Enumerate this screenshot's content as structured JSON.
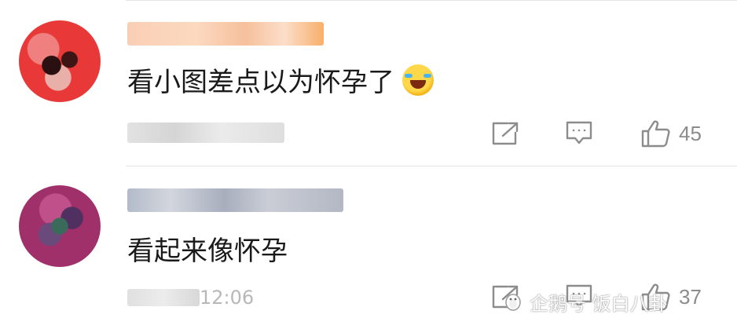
{
  "comments": [
    {
      "username": "",
      "text": "看小图差点以为怀孕了",
      "emoji": "tears-of-joy-emoji",
      "timestamp": "",
      "like_count": "45"
    },
    {
      "username": "",
      "text": "看起来像怀孕",
      "timestamp": "12:06",
      "like_count": "37"
    }
  ],
  "icons": {
    "share": "share-icon",
    "comment": "comment-icon",
    "like": "thumbs-up-icon"
  },
  "watermark": {
    "text": "企鹅号 饭白八卦"
  },
  "colors": {
    "text": "#1a1a1a",
    "meta": "#8c8c8c",
    "divider": "#e4e4e4"
  }
}
